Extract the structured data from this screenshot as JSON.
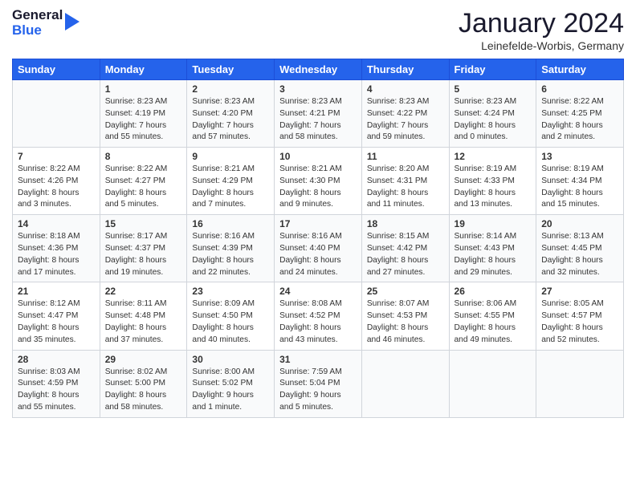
{
  "header": {
    "logo_line1": "General",
    "logo_line2": "Blue",
    "month": "January 2024",
    "location": "Leinefelde-Worbis, Germany"
  },
  "days_of_week": [
    "Sunday",
    "Monday",
    "Tuesday",
    "Wednesday",
    "Thursday",
    "Friday",
    "Saturday"
  ],
  "weeks": [
    [
      {
        "day": "",
        "content": ""
      },
      {
        "day": "1",
        "content": "Sunrise: 8:23 AM\nSunset: 4:19 PM\nDaylight: 7 hours\nand 55 minutes."
      },
      {
        "day": "2",
        "content": "Sunrise: 8:23 AM\nSunset: 4:20 PM\nDaylight: 7 hours\nand 57 minutes."
      },
      {
        "day": "3",
        "content": "Sunrise: 8:23 AM\nSunset: 4:21 PM\nDaylight: 7 hours\nand 58 minutes."
      },
      {
        "day": "4",
        "content": "Sunrise: 8:23 AM\nSunset: 4:22 PM\nDaylight: 7 hours\nand 59 minutes."
      },
      {
        "day": "5",
        "content": "Sunrise: 8:23 AM\nSunset: 4:24 PM\nDaylight: 8 hours\nand 0 minutes."
      },
      {
        "day": "6",
        "content": "Sunrise: 8:22 AM\nSunset: 4:25 PM\nDaylight: 8 hours\nand 2 minutes."
      }
    ],
    [
      {
        "day": "7",
        "content": "Sunrise: 8:22 AM\nSunset: 4:26 PM\nDaylight: 8 hours\nand 3 minutes."
      },
      {
        "day": "8",
        "content": "Sunrise: 8:22 AM\nSunset: 4:27 PM\nDaylight: 8 hours\nand 5 minutes."
      },
      {
        "day": "9",
        "content": "Sunrise: 8:21 AM\nSunset: 4:29 PM\nDaylight: 8 hours\nand 7 minutes."
      },
      {
        "day": "10",
        "content": "Sunrise: 8:21 AM\nSunset: 4:30 PM\nDaylight: 8 hours\nand 9 minutes."
      },
      {
        "day": "11",
        "content": "Sunrise: 8:20 AM\nSunset: 4:31 PM\nDaylight: 8 hours\nand 11 minutes."
      },
      {
        "day": "12",
        "content": "Sunrise: 8:19 AM\nSunset: 4:33 PM\nDaylight: 8 hours\nand 13 minutes."
      },
      {
        "day": "13",
        "content": "Sunrise: 8:19 AM\nSunset: 4:34 PM\nDaylight: 8 hours\nand 15 minutes."
      }
    ],
    [
      {
        "day": "14",
        "content": "Sunrise: 8:18 AM\nSunset: 4:36 PM\nDaylight: 8 hours\nand 17 minutes."
      },
      {
        "day": "15",
        "content": "Sunrise: 8:17 AM\nSunset: 4:37 PM\nDaylight: 8 hours\nand 19 minutes."
      },
      {
        "day": "16",
        "content": "Sunrise: 8:16 AM\nSunset: 4:39 PM\nDaylight: 8 hours\nand 22 minutes."
      },
      {
        "day": "17",
        "content": "Sunrise: 8:16 AM\nSunset: 4:40 PM\nDaylight: 8 hours\nand 24 minutes."
      },
      {
        "day": "18",
        "content": "Sunrise: 8:15 AM\nSunset: 4:42 PM\nDaylight: 8 hours\nand 27 minutes."
      },
      {
        "day": "19",
        "content": "Sunrise: 8:14 AM\nSunset: 4:43 PM\nDaylight: 8 hours\nand 29 minutes."
      },
      {
        "day": "20",
        "content": "Sunrise: 8:13 AM\nSunset: 4:45 PM\nDaylight: 8 hours\nand 32 minutes."
      }
    ],
    [
      {
        "day": "21",
        "content": "Sunrise: 8:12 AM\nSunset: 4:47 PM\nDaylight: 8 hours\nand 35 minutes."
      },
      {
        "day": "22",
        "content": "Sunrise: 8:11 AM\nSunset: 4:48 PM\nDaylight: 8 hours\nand 37 minutes."
      },
      {
        "day": "23",
        "content": "Sunrise: 8:09 AM\nSunset: 4:50 PM\nDaylight: 8 hours\nand 40 minutes."
      },
      {
        "day": "24",
        "content": "Sunrise: 8:08 AM\nSunset: 4:52 PM\nDaylight: 8 hours\nand 43 minutes."
      },
      {
        "day": "25",
        "content": "Sunrise: 8:07 AM\nSunset: 4:53 PM\nDaylight: 8 hours\nand 46 minutes."
      },
      {
        "day": "26",
        "content": "Sunrise: 8:06 AM\nSunset: 4:55 PM\nDaylight: 8 hours\nand 49 minutes."
      },
      {
        "day": "27",
        "content": "Sunrise: 8:05 AM\nSunset: 4:57 PM\nDaylight: 8 hours\nand 52 minutes."
      }
    ],
    [
      {
        "day": "28",
        "content": "Sunrise: 8:03 AM\nSunset: 4:59 PM\nDaylight: 8 hours\nand 55 minutes."
      },
      {
        "day": "29",
        "content": "Sunrise: 8:02 AM\nSunset: 5:00 PM\nDaylight: 8 hours\nand 58 minutes."
      },
      {
        "day": "30",
        "content": "Sunrise: 8:00 AM\nSunset: 5:02 PM\nDaylight: 9 hours\nand 1 minute."
      },
      {
        "day": "31",
        "content": "Sunrise: 7:59 AM\nSunset: 5:04 PM\nDaylight: 9 hours\nand 5 minutes."
      },
      {
        "day": "",
        "content": ""
      },
      {
        "day": "",
        "content": ""
      },
      {
        "day": "",
        "content": ""
      }
    ]
  ]
}
